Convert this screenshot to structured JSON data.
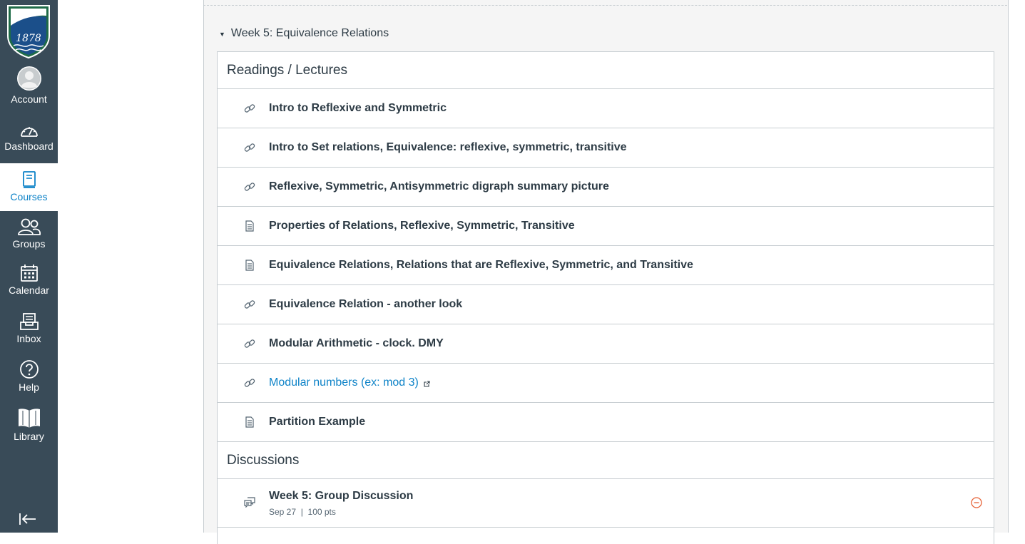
{
  "nav": {
    "logo_text": "1878",
    "items": [
      {
        "label": "Account",
        "icon": "account-icon"
      },
      {
        "label": "Dashboard",
        "icon": "dashboard-icon"
      },
      {
        "label": "Courses",
        "icon": "courses-icon",
        "active": true
      },
      {
        "label": "Groups",
        "icon": "groups-icon"
      },
      {
        "label": "Calendar",
        "icon": "calendar-icon"
      },
      {
        "label": "Inbox",
        "icon": "inbox-icon"
      },
      {
        "label": "Help",
        "icon": "help-icon"
      },
      {
        "label": "Library",
        "icon": "library-icon"
      }
    ],
    "collapse_icon": "collapse-nav-icon"
  },
  "module": {
    "title": "Week 5: Equivalence Relations",
    "sections": [
      {
        "heading": "Readings / Lectures",
        "items": [
          {
            "title": "Intro to Reflexive and Symmetric",
            "icon": "link-icon"
          },
          {
            "title": "Intro to Set relations, Equivalence: reflexive, symmetric, transitive",
            "icon": "link-icon"
          },
          {
            "title": "Reflexive, Symmetric, Antisymmetric digraph summary picture",
            "icon": "link-icon"
          },
          {
            "title": "Properties of Relations, Reflexive, Symmetric, Transitive",
            "icon": "page-icon"
          },
          {
            "title": "Equivalence Relations, Relations that are Reflexive, Symmetric, and Transitive",
            "icon": "page-icon"
          },
          {
            "title": "Equivalence Relation - another look",
            "icon": "link-icon"
          },
          {
            "title": "Modular Arithmetic - clock. DMY",
            "icon": "link-icon"
          },
          {
            "title": "Modular numbers (ex: mod 3)",
            "icon": "link-icon",
            "external": true
          },
          {
            "title": "Partition Example",
            "icon": "page-icon"
          }
        ]
      },
      {
        "heading": "Discussions",
        "items": [
          {
            "title": "Week 5: Group Discussion",
            "icon": "discussion-icon",
            "date": "Sep 27",
            "separator": "|",
            "points": "100 pts",
            "status_icon": "minus-circle-icon"
          }
        ]
      }
    ]
  },
  "colors": {
    "nav_bg": "#394b58",
    "accent": "#0e83c8",
    "status_orange": "#e66135",
    "logo_green": "#1f6b47"
  }
}
